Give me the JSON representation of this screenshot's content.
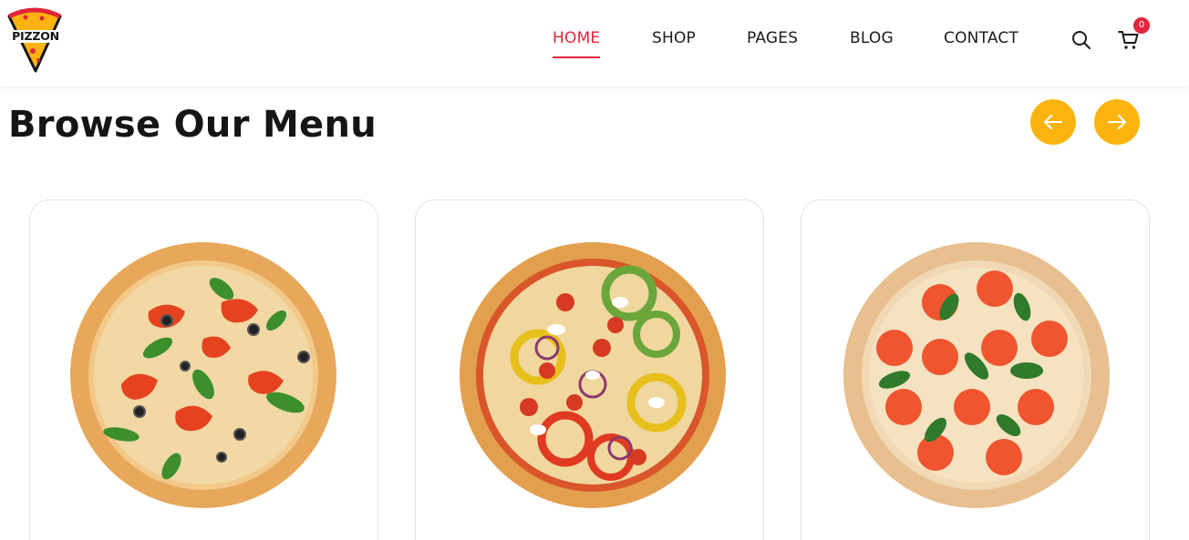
{
  "brand": {
    "name": "PIZZON",
    "logo_icon": "pizza-slice-icon"
  },
  "nav": {
    "items": [
      {
        "label": "HOME",
        "active": true
      },
      {
        "label": "SHOP",
        "active": false
      },
      {
        "label": "PAGES",
        "active": false
      },
      {
        "label": "BLOG",
        "active": false
      },
      {
        "label": "CONTACT",
        "active": false
      }
    ],
    "search_icon": "search-icon",
    "cart_icon": "cart-icon",
    "cart_count": "0"
  },
  "section": {
    "title": "Browse Our Menu",
    "prev_icon": "arrow-left-icon",
    "next_icon": "arrow-right-icon"
  },
  "menu_items": [
    {
      "image": "pizza-vegetable-olive-pepper"
    },
    {
      "image": "pizza-bell-pepper-onion"
    },
    {
      "image": "pizza-tomato-basil"
    }
  ],
  "colors": {
    "accent": "#e0263b",
    "button": "#fbb40f",
    "text": "#151515"
  }
}
